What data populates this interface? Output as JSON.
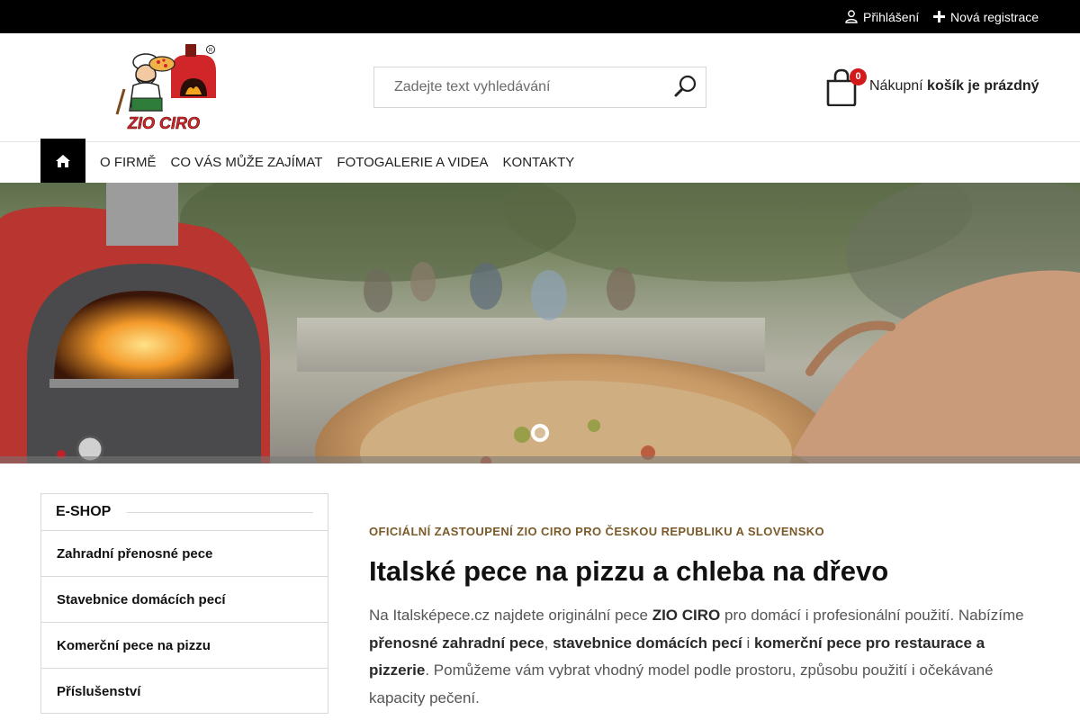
{
  "topbar": {
    "login_label": "Přihlášení",
    "register_label": "Nová registrace"
  },
  "header": {
    "logo_text": "ZIO CIRO",
    "search": {
      "placeholder": "Zadejte text vyhledávání",
      "value": ""
    },
    "cart": {
      "count": "0",
      "label_prefix": "Nákupní",
      "label_state": "košík je prázdný"
    }
  },
  "nav": {
    "items": [
      {
        "label": "O FIRMĚ"
      },
      {
        "label": "CO VÁS MŮŽE ZAJÍMAT"
      },
      {
        "label": "FOTOGALERIE A VIDEA"
      },
      {
        "label": "KONTAKTY"
      }
    ]
  },
  "sidebar": {
    "title": "E-SHOP",
    "items": [
      {
        "label": "Zahradní přenosné pece"
      },
      {
        "label": "Stavebnice domácích pecí"
      },
      {
        "label": "Komerční pece na pizzu"
      },
      {
        "label": "Příslušenství"
      }
    ]
  },
  "main": {
    "kicker": "OFICIÁLNÍ ZASTOUPENÍ ZIO CIRO PRO ČESKOU REPUBLIKU A SLOVENSKO",
    "headline": "Italské pece na pizzu a chleba na dřevo",
    "intro": {
      "t1": "Na Italsképece.cz najdete originální pece ",
      "b1": "ZIO CIRO",
      "t2": " pro domácí i profesionální použití. Nabízíme ",
      "b2": "přenosné zahradní pece",
      "t3": ", ",
      "b3": "stavebnice domácích pecí",
      "t4": " i ",
      "b4": "komerční pece pro restaurace a pizzerie",
      "t5": ". Pomůžeme vám vybrat vhodný model podle prostoru, způsobu použití i očekávané kapacity pečení."
    }
  },
  "colors": {
    "topbar_bg": "#000000",
    "home_button_bg": "#000000",
    "cart_badge": "#d21a1a",
    "kicker": "#7b5a2a",
    "logo_red": "#d0262a"
  }
}
